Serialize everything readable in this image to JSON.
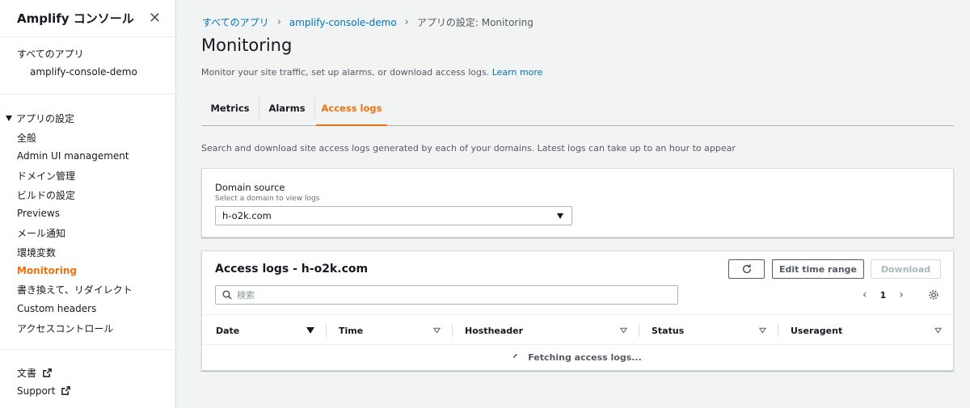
{
  "sidebar": {
    "title": "Amplify コンソール",
    "all_apps": "すべてのアプリ",
    "app_name": "amplify-console-demo",
    "section_title": "アプリの設定",
    "items": [
      {
        "label": "全般"
      },
      {
        "label": "Admin UI management"
      },
      {
        "label": "ドメイン管理"
      },
      {
        "label": "ビルドの設定"
      },
      {
        "label": "Previews"
      },
      {
        "label": "メール通知"
      },
      {
        "label": "環境変数"
      },
      {
        "label": "Monitoring",
        "active": true
      },
      {
        "label": "書き換えて、リダイレクト"
      },
      {
        "label": "Custom headers"
      },
      {
        "label": "アクセスコントロール"
      }
    ],
    "footer": [
      {
        "label": "文書"
      },
      {
        "label": "Support"
      }
    ]
  },
  "breadcrumb": {
    "root": "すべてのアプリ",
    "app": "amplify-console-demo",
    "current": "アプリの設定: Monitoring"
  },
  "page": {
    "title": "Monitoring",
    "description": "Monitor your site traffic, set up alarms, or download access logs.",
    "learn_more": "Learn more"
  },
  "tabs": [
    {
      "label": "Metrics"
    },
    {
      "label": "Alarms"
    },
    {
      "label": "Access logs",
      "active": true
    }
  ],
  "access_logs": {
    "section_description": "Search and download site access logs generated by each of your domains. Latest logs can take up to an hour to appear",
    "domain_source": {
      "label": "Domain source",
      "sublabel": "Select a domain to view logs",
      "value": "h-o2k.com"
    },
    "table": {
      "title": "Access logs - h-o2k.com",
      "edit_time_range": "Edit time range",
      "download": "Download",
      "search_placeholder": "検索",
      "page_number": "1",
      "columns": [
        {
          "label": "Date",
          "sorted": true
        },
        {
          "label": "Time"
        },
        {
          "label": "Hostheader"
        },
        {
          "label": "Status"
        },
        {
          "label": "Useragent"
        }
      ],
      "loading_text": "Fetching access logs..."
    }
  },
  "colors": {
    "accent": "#ec7211",
    "link": "#0073bb",
    "background": "#f2f3f3"
  }
}
